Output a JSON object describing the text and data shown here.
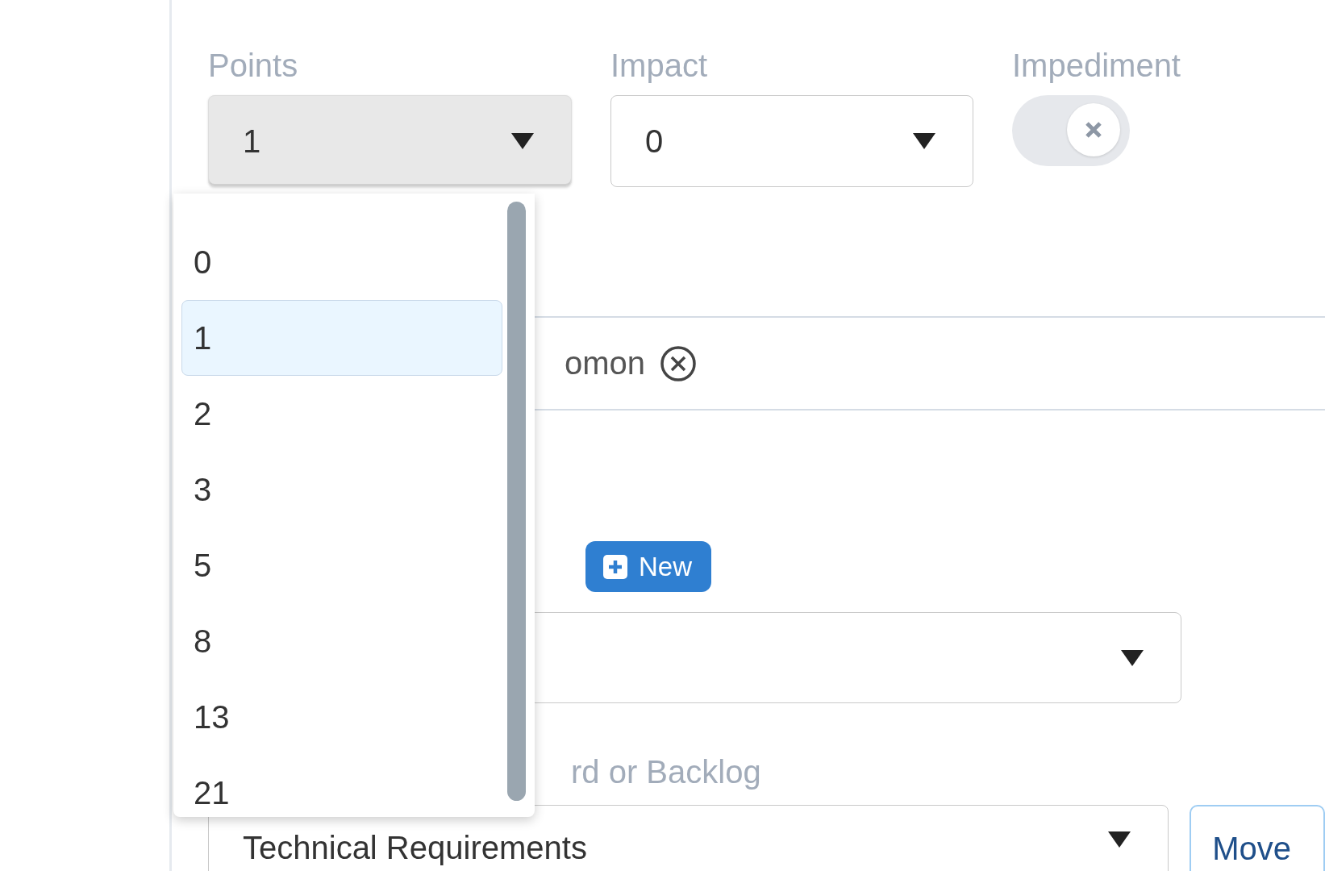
{
  "fields": [
    {
      "label": "Points",
      "value": "1",
      "open": true
    },
    {
      "label": "Impact",
      "value": "0",
      "open": false
    }
  ],
  "impediment": {
    "label": "Impediment",
    "on": false
  },
  "points_menu": {
    "options": [
      {
        "label": "0",
        "selected": false
      },
      {
        "label": "1",
        "selected": true
      },
      {
        "label": "2",
        "selected": false
      },
      {
        "label": "3",
        "selected": false
      },
      {
        "label": "5",
        "selected": false
      },
      {
        "label": "8",
        "selected": false
      },
      {
        "label": "13",
        "selected": false
      },
      {
        "label": "21",
        "selected": false
      }
    ]
  },
  "tags_field": {
    "tags": [
      {
        "label": "omon"
      }
    ]
  },
  "new_button": {
    "label": "New"
  },
  "board": {
    "label": "rd or Backlog",
    "value": "Technical Requirements",
    "button": "Move"
  }
}
